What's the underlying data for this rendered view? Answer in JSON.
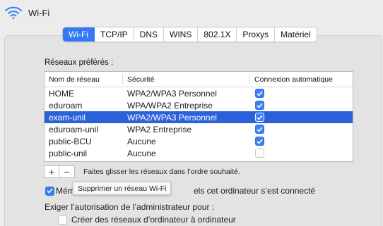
{
  "header": {
    "title": "Wi-Fi",
    "icon": "wifi-icon"
  },
  "tabs": [
    {
      "label": "Wi-Fi",
      "active": true
    },
    {
      "label": "TCP/IP",
      "active": false
    },
    {
      "label": "DNS",
      "active": false
    },
    {
      "label": "WINS",
      "active": false
    },
    {
      "label": "802.1X",
      "active": false
    },
    {
      "label": "Proxys",
      "active": false
    },
    {
      "label": "Matériel",
      "active": false
    }
  ],
  "preferred_networks": {
    "label": "Réseaux préférés :",
    "columns": [
      "Nom de réseau",
      "Sécurité",
      "Connexion automatique"
    ],
    "rows": [
      {
        "name": "HOME",
        "security": "WPA2/WPA3 Personnel",
        "auto": true,
        "selected": false
      },
      {
        "name": "eduroam",
        "security": "WPA/WPA2 Entreprise",
        "auto": true,
        "selected": false
      },
      {
        "name": "exam-unil",
        "security": "WPA2/WPA3 Personnel",
        "auto": true,
        "selected": true
      },
      {
        "name": "eduroam-unil",
        "security": "WPA2 Entreprise",
        "auto": true,
        "selected": false
      },
      {
        "name": "public-BCU",
        "security": "Aucune",
        "auto": true,
        "selected": false
      },
      {
        "name": "public-unil",
        "security": "Aucune",
        "auto": false,
        "selected": false
      }
    ]
  },
  "controls": {
    "add_label": "+",
    "remove_label": "−",
    "hint": "Faites glisser les réseaux dans l’ordre souhaité.",
    "tooltip": "Supprimer un réseau Wi-Fi"
  },
  "options": {
    "remember_prefix": "Mém",
    "remember_suffix": "els cet ordinateur s’est connecté",
    "remember_checked": true,
    "admin_label": "Exiger l’autorisation de l’administrateur pour :",
    "create_label": "Créer des réseaux d’ordinateur à ordinateur",
    "create_checked": false
  },
  "colors": {
    "accent": "#3478f6",
    "selection": "#2b62d9",
    "background": "#ececec"
  }
}
